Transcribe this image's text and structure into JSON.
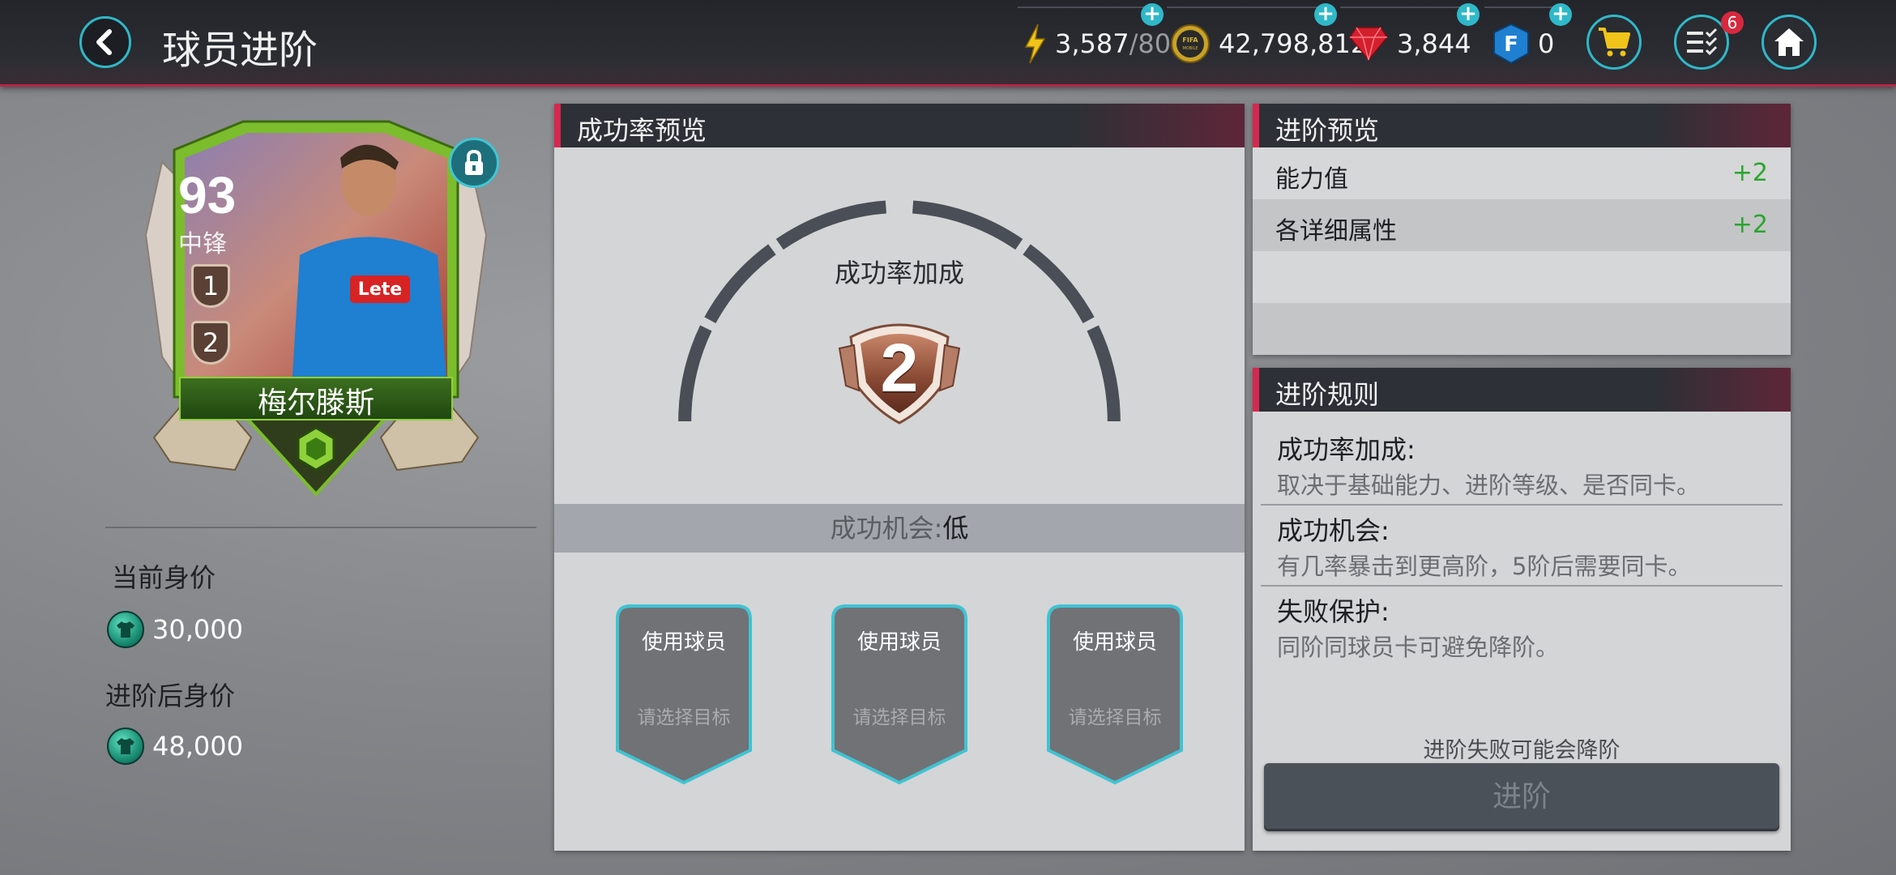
{
  "header": {
    "title": "球员进阶",
    "energy": "3,587",
    "energy_max": "/80",
    "coins": "42,798,812",
    "gems": "3,844",
    "fifa_points": "0",
    "coin_logo_text": "FIFA MOBILE",
    "tasks_badge": "6"
  },
  "player_card": {
    "rating": "93",
    "position": "中锋",
    "rank_top": "1",
    "rank_bottom": "2",
    "name": "梅尔滕斯",
    "sponsor_text": "Lete"
  },
  "values": {
    "current_label": "当前身价",
    "current_value": "30,000",
    "after_label": "进阶后身价",
    "after_value": "48,000"
  },
  "success_preview": {
    "title": "成功率预览",
    "boost_label": "成功率加成",
    "boost_level": "2",
    "chance_label": "成功机会:",
    "chance_value": "低",
    "slots": [
      {
        "label": "使用球员",
        "hint": "请选择目标"
      },
      {
        "label": "使用球员",
        "hint": "请选择目标"
      },
      {
        "label": "使用球员",
        "hint": "请选择目标"
      }
    ]
  },
  "advance_preview": {
    "title": "进阶预览",
    "rows": [
      {
        "name": "能力值",
        "value": "+2"
      },
      {
        "name": "各详细属性",
        "value": "+2"
      }
    ]
  },
  "rules": {
    "title": "进阶规则",
    "items": [
      {
        "heading": "成功率加成:",
        "desc": "取决于基础能力、进阶等级、是否同卡。"
      },
      {
        "heading": "成功机会:",
        "desc": "有几率暴击到更高阶，5阶后需要同卡。"
      },
      {
        "heading": "失败保护:",
        "desc": "同阶同球员卡可避免降阶。"
      }
    ],
    "warning": "进阶失败可能会降阶",
    "button": "进阶"
  },
  "colors": {
    "accent": "#2fb8c9",
    "header_stripe": "#d6284f",
    "positive": "#2aa52e"
  }
}
